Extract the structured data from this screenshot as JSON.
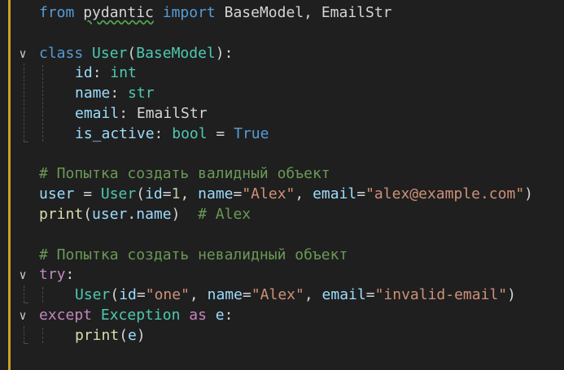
{
  "editor": {
    "lines": [
      {
        "tokens": [
          [
            "kw",
            "from"
          ],
          [
            "plain",
            " "
          ],
          [
            "plain squig",
            "pydantic"
          ],
          [
            "plain",
            " "
          ],
          [
            "kw",
            "import"
          ],
          [
            "plain",
            " BaseModel, EmailStr"
          ]
        ]
      },
      {
        "tokens": []
      },
      {
        "fold": true,
        "tokens": [
          [
            "kw",
            "class"
          ],
          [
            "plain",
            " "
          ],
          [
            "cls",
            "User"
          ],
          [
            "plain",
            "("
          ],
          [
            "cls",
            "BaseModel"
          ],
          [
            "plain",
            "):"
          ]
        ]
      },
      {
        "indent": 1,
        "tokens": [
          [
            "var",
            "id"
          ],
          [
            "plain",
            ": "
          ],
          [
            "cls",
            "int"
          ]
        ]
      },
      {
        "indent": 1,
        "tokens": [
          [
            "var",
            "name"
          ],
          [
            "plain",
            ": "
          ],
          [
            "cls",
            "str"
          ]
        ]
      },
      {
        "indent": 1,
        "tokens": [
          [
            "var",
            "email"
          ],
          [
            "plain",
            ": EmailStr"
          ]
        ]
      },
      {
        "indent": 1,
        "tokens": [
          [
            "var",
            "is_active"
          ],
          [
            "plain",
            ": "
          ],
          [
            "cls",
            "bool"
          ],
          [
            "plain",
            " = "
          ],
          [
            "kw",
            "True"
          ]
        ]
      },
      {
        "tokens": []
      },
      {
        "tokens": [
          [
            "cmt",
            "# Попытка создать валидный объект"
          ]
        ]
      },
      {
        "tokens": [
          [
            "var",
            "user"
          ],
          [
            "plain",
            " = "
          ],
          [
            "cls",
            "User"
          ],
          [
            "plain",
            "("
          ],
          [
            "var",
            "id"
          ],
          [
            "plain",
            "="
          ],
          [
            "num",
            "1"
          ],
          [
            "plain",
            ", "
          ],
          [
            "var",
            "name"
          ],
          [
            "plain",
            "="
          ],
          [
            "str",
            "\"Alex\""
          ],
          [
            "plain",
            ", "
          ],
          [
            "var",
            "email"
          ],
          [
            "plain",
            "="
          ],
          [
            "str",
            "\"alex@example.com\""
          ],
          [
            "plain",
            ")"
          ]
        ]
      },
      {
        "tokens": [
          [
            "fn",
            "print"
          ],
          [
            "plain",
            "("
          ],
          [
            "var",
            "user"
          ],
          [
            "plain",
            "."
          ],
          [
            "var",
            "name"
          ],
          [
            "plain",
            ")  "
          ],
          [
            "cmt",
            "# Alex"
          ]
        ]
      },
      {
        "tokens": []
      },
      {
        "tokens": [
          [
            "cmt",
            "# Попытка создать невалидный объект"
          ]
        ]
      },
      {
        "fold": true,
        "tokens": [
          [
            "ctl",
            "try"
          ],
          [
            "plain",
            ":"
          ]
        ]
      },
      {
        "indent": 1,
        "tokens": [
          [
            "cls",
            "User"
          ],
          [
            "plain",
            "("
          ],
          [
            "var",
            "id"
          ],
          [
            "plain",
            "="
          ],
          [
            "str",
            "\"one\""
          ],
          [
            "plain",
            ", "
          ],
          [
            "var",
            "name"
          ],
          [
            "plain",
            "="
          ],
          [
            "str",
            "\"Alex\""
          ],
          [
            "plain",
            ", "
          ],
          [
            "var",
            "email"
          ],
          [
            "plain",
            "="
          ],
          [
            "str",
            "\"invalid-email\""
          ],
          [
            "plain",
            ")"
          ]
        ]
      },
      {
        "fold": true,
        "tokens": [
          [
            "ctl",
            "except"
          ],
          [
            "plain",
            " "
          ],
          [
            "cls",
            "Exception"
          ],
          [
            "plain",
            " "
          ],
          [
            "ctl",
            "as"
          ],
          [
            "plain",
            " "
          ],
          [
            "var",
            "e"
          ],
          [
            "plain",
            ":"
          ]
        ]
      },
      {
        "indent": 1,
        "tokens": [
          [
            "fn",
            "print"
          ],
          [
            "plain",
            "("
          ],
          [
            "var",
            "e"
          ],
          [
            "plain",
            ")"
          ]
        ]
      }
    ],
    "fold_icon": "chevron-down-icon",
    "fold_glyph": "∨"
  },
  "colors": {
    "background": "#1f1f1f",
    "modified_bar": "#c9a227",
    "keyword": "#569cd6",
    "class_name": "#4ec9b0",
    "function": "#dcdcaa",
    "variable": "#9cdcfe",
    "string": "#ce9178",
    "number": "#b5cea8",
    "comment": "#6a9955"
  }
}
